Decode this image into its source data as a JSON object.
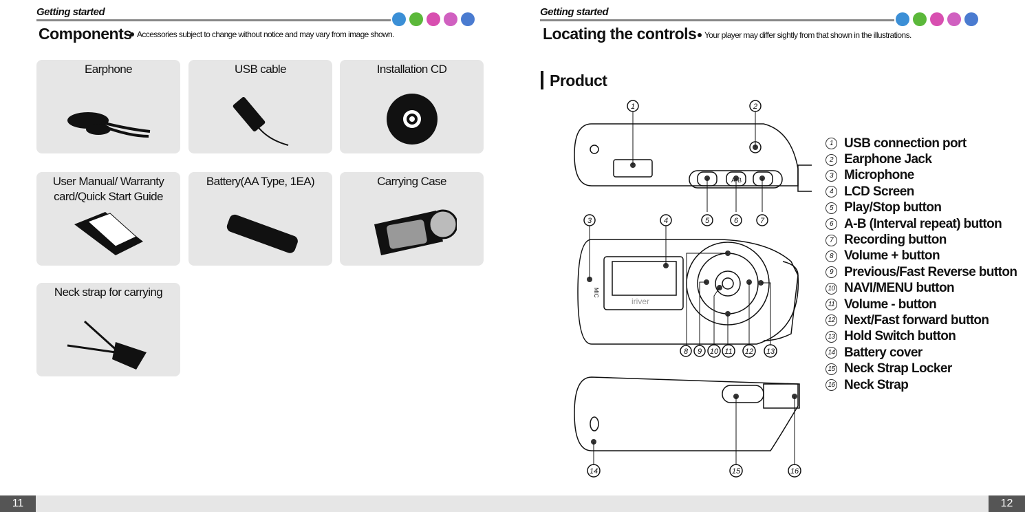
{
  "left": {
    "section": "Getting started",
    "title": "Components",
    "note": "Accessories subject to change without notice and may vary from image shown.",
    "items": [
      {
        "label": "Earphone"
      },
      {
        "label": "USB cable"
      },
      {
        "label": "Installation CD"
      },
      {
        "label": "User Manual/ Warranty card/Quick Start Guide"
      },
      {
        "label": "Battery(AA Type, 1EA)"
      },
      {
        "label": "Carrying Case"
      },
      {
        "label": "Neck strap for carrying"
      }
    ],
    "page": "11"
  },
  "right": {
    "section": "Getting started",
    "title": "Locating the controls",
    "note": "Your player may differ sightly from that shown in the illustrations.",
    "subtitle": "Product",
    "controls": [
      {
        "n": "1",
        "label": "USB connection port"
      },
      {
        "n": "2",
        "label": "Earphone Jack"
      },
      {
        "n": "3",
        "label": "Microphone"
      },
      {
        "n": "4",
        "label": "LCD Screen"
      },
      {
        "n": "5",
        "label": "Play/Stop button"
      },
      {
        "n": "6",
        "label": "A-B (Interval repeat) button"
      },
      {
        "n": "7",
        "label": "Recording button"
      },
      {
        "n": "8",
        "label": "Volume + button"
      },
      {
        "n": "9",
        "label": "Previous/Fast Reverse button"
      },
      {
        "n": "10",
        "label": "NAVI/MENU button"
      },
      {
        "n": "11",
        "label": "Volume - button"
      },
      {
        "n": "12",
        "label": "Next/Fast forward button"
      },
      {
        "n": "13",
        "label": "Hold Switch button"
      },
      {
        "n": "14",
        "label": "Battery cover"
      },
      {
        "n": "15",
        "label": "Neck Strap Locker"
      },
      {
        "n": "16",
        "label": "Neck Strap"
      }
    ],
    "device": {
      "brand": "iriver",
      "mic": "MIC",
      "ab": "A-B"
    },
    "page": "12"
  },
  "icon_colors": [
    "#3b8fd6",
    "#5bb83a",
    "#d84fb0",
    "#d060c0",
    "#4a7bd0"
  ]
}
